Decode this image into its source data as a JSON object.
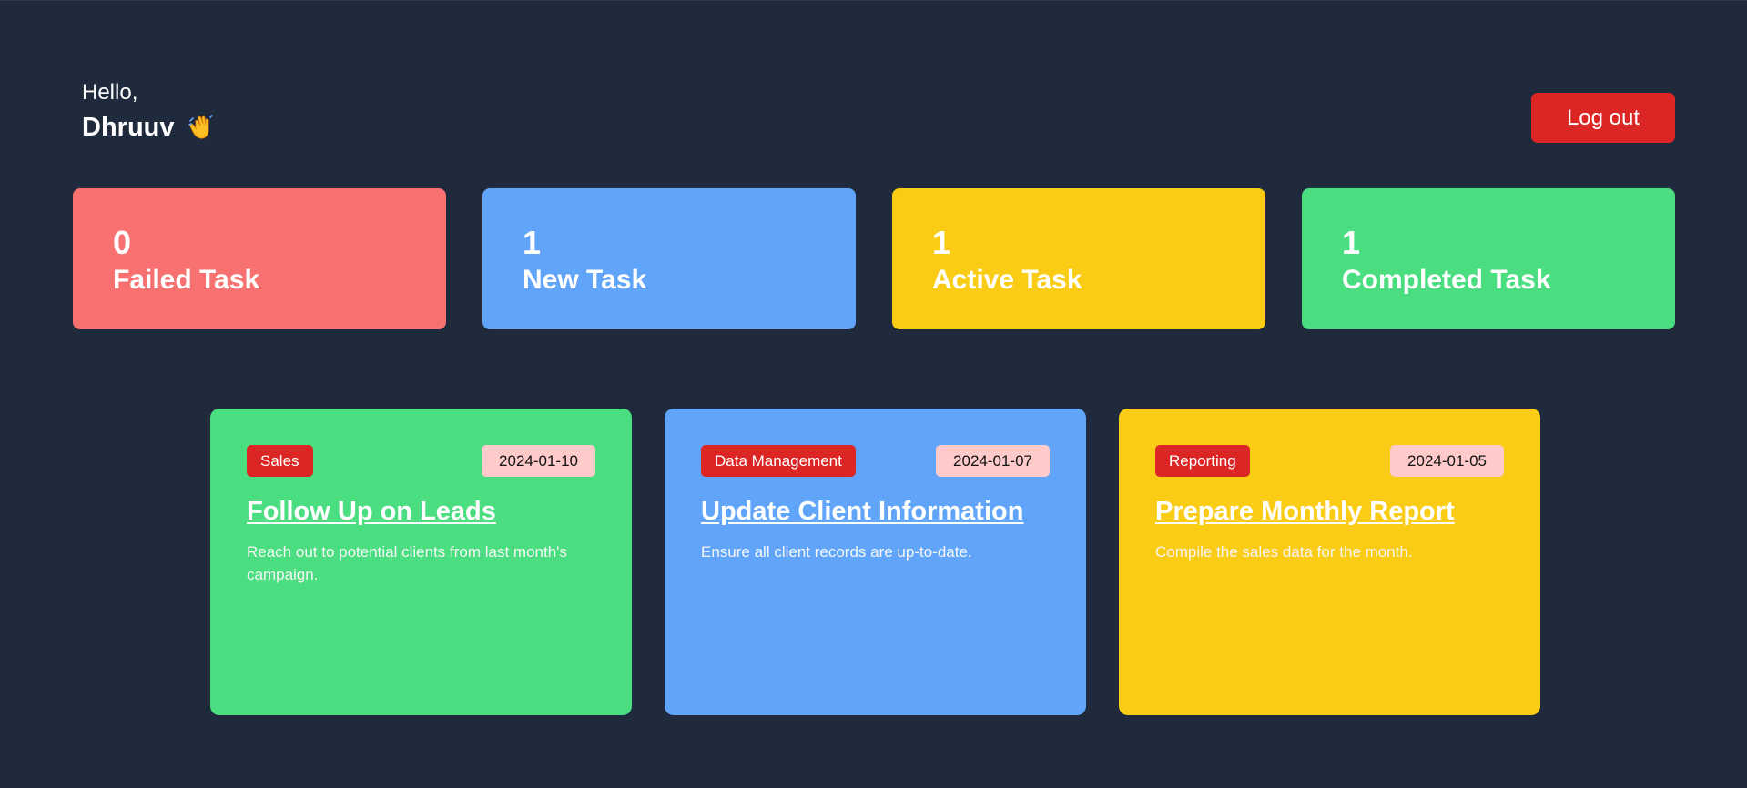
{
  "header": {
    "greeting": "Hello,",
    "username": "Dhruuv",
    "wave_icon": "waving-hand-icon",
    "logout_label": "Log out"
  },
  "stats": [
    {
      "count": "0",
      "label": "Failed Task",
      "color": "#f87171"
    },
    {
      "count": "1",
      "label": "New Task",
      "color": "#60a5fa"
    },
    {
      "count": "1",
      "label": "Active Task",
      "color": "#facc15"
    },
    {
      "count": "1",
      "label": "Completed Task",
      "color": "#4ade80"
    }
  ],
  "tasks": [
    {
      "category": "Sales",
      "date": "2024-01-10",
      "title": "Follow Up on Leads",
      "description": "Reach out to potential clients from last month's campaign.",
      "color": "#4ade80"
    },
    {
      "category": "Data Management",
      "date": "2024-01-07",
      "title": "Update Client Information",
      "description": "Ensure all client records are up-to-date.",
      "color": "#60a5fa"
    },
    {
      "category": "Reporting",
      "date": "2024-01-05",
      "title": "Prepare Monthly Report",
      "description": "Compile the sales data for the month.",
      "color": "#facc15"
    }
  ]
}
